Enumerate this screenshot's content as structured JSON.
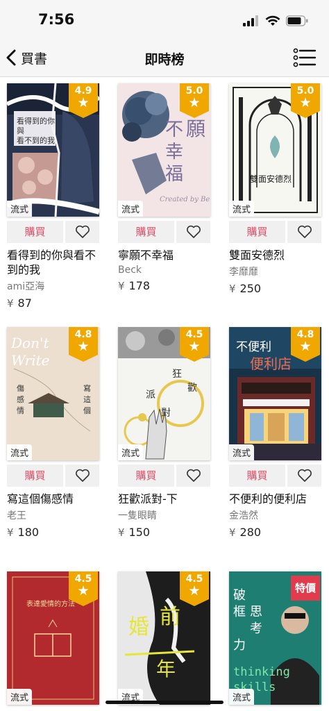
{
  "status_bar": {
    "time": "7:56"
  },
  "nav": {
    "back_label": "買書",
    "title": "即時榜"
  },
  "labels": {
    "buy": "購買",
    "stream": "流式",
    "special": "特價",
    "currency": "¥"
  },
  "books": [
    {
      "title": "看得到的你與看不到的我",
      "author": "ami亞海",
      "price": "87",
      "rating": "4.9",
      "cover_text": "看得到的你與看不到的我",
      "color": "#2a3550"
    },
    {
      "title": "寧願不幸福",
      "author": "Beck",
      "price": "178",
      "rating": "5.0",
      "cover_text": "寧願不幸福",
      "color": "#f3e5e6"
    },
    {
      "title": "雙面安德烈",
      "author": "李靡靡",
      "price": "250",
      "rating": "5.0",
      "cover_text": "雙面安德烈",
      "color": "#f7f7f2"
    },
    {
      "title": "寫這個傷感情",
      "author": "老王",
      "price": "180",
      "rating": "4.8",
      "cover_text": "Don't Write",
      "color": "#ecdfcf"
    },
    {
      "title": "狂歡派對-下",
      "author": "一隻眼睛",
      "price": "150",
      "rating": "4.5",
      "cover_text": "狂歡派對",
      "color": "#f4f4f0"
    },
    {
      "title": "不便利的便利店",
      "author": "金浩然",
      "price": "280",
      "rating": "4.8",
      "cover_text": "不便利便利店",
      "color": "#183348"
    },
    {
      "title": "",
      "author": "",
      "price": "",
      "rating": "4.5",
      "cover_text": "表達愛情的方法",
      "color": "#b32a2e"
    },
    {
      "title": "",
      "author": "",
      "price": "",
      "rating": "4.5",
      "cover_text": "婚前一年",
      "color": "#e8e8e8"
    },
    {
      "title": "",
      "author": "",
      "price": "",
      "rating": "",
      "special": true,
      "cover_text": "破框思考力",
      "color": "#1f7e72"
    }
  ]
}
